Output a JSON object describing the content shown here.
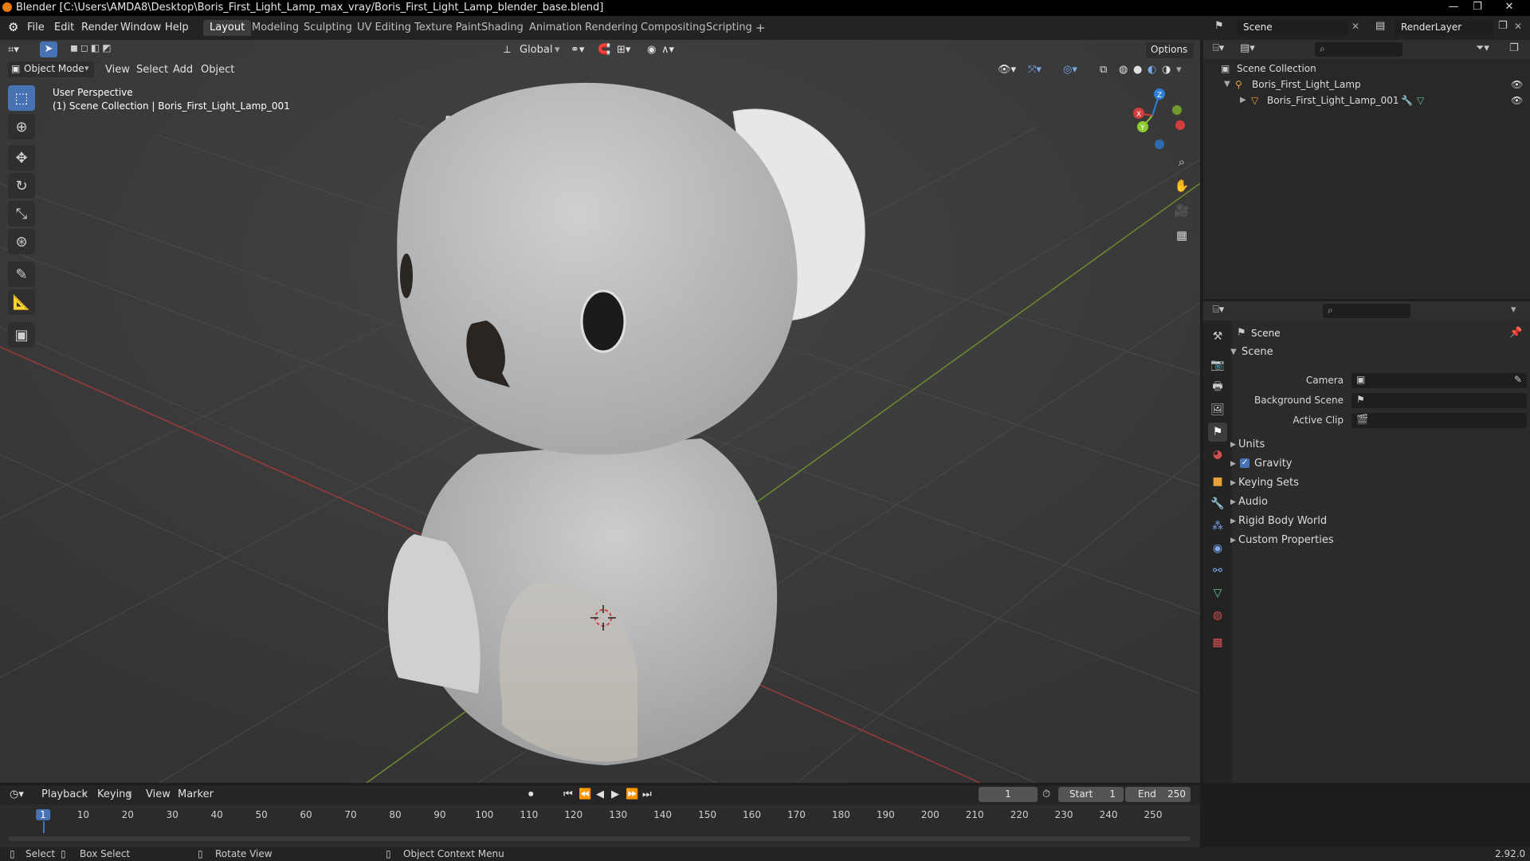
{
  "titlebar": {
    "title": "Blender [C:\\Users\\AMDA8\\Desktop\\Boris_First_Light_Lamp_max_vray/Boris_First_Light_Lamp_blender_base.blend]",
    "min": "—",
    "max": "❐",
    "close": "✕"
  },
  "menu": [
    "File",
    "Edit",
    "Render",
    "Window",
    "Help"
  ],
  "workspaces": [
    "Layout",
    "Modeling",
    "Sculpting",
    "UV Editing",
    "Texture Paint",
    "Shading",
    "Animation",
    "Rendering",
    "Compositing",
    "Scripting"
  ],
  "add_tab": "+",
  "scene_field": "Scene",
  "renderlayer_field": "RenderLayer",
  "viewport": {
    "transform_orientation": "Global",
    "options": "Options",
    "mode": "Object Mode",
    "menus": [
      "View",
      "Select",
      "Add",
      "Object"
    ],
    "overlay_text": "User Perspective",
    "collection_text": "(1) Scene Collection | Boris_First_Light_Lamp_001",
    "gizmo": {
      "x": "X",
      "y": "Y",
      "z": "Z"
    }
  },
  "outliner": {
    "root": "Scene Collection",
    "items": [
      {
        "label": "Boris_First_Light_Lamp"
      },
      {
        "label": "Boris_First_Light_Lamp_001"
      }
    ]
  },
  "properties": {
    "title": "Scene",
    "section": "Scene",
    "fields": [
      {
        "label": "Camera"
      },
      {
        "label": "Background Scene"
      },
      {
        "label": "Active Clip"
      }
    ],
    "subsections": [
      "Units",
      "Gravity",
      "Keying Sets",
      "Audio",
      "Rigid Body World",
      "Custom Properties"
    ],
    "gravity_checked": true
  },
  "timeline": {
    "menus": [
      "Playback",
      "Keying",
      "View",
      "Marker"
    ],
    "current_frame": "1",
    "start_label": "Start",
    "start": "1",
    "end_label": "End",
    "end": "250",
    "ticks": [
      "1",
      "10",
      "20",
      "30",
      "40",
      "50",
      "60",
      "70",
      "80",
      "90",
      "100",
      "110",
      "120",
      "130",
      "140",
      "150",
      "160",
      "170",
      "180",
      "190",
      "200",
      "210",
      "220",
      "230",
      "240",
      "250"
    ]
  },
  "statusbar": {
    "select": "Select",
    "box_select": "Box Select",
    "rotate_view": "Rotate View",
    "context_menu": "Object Context Menu",
    "version": "2.92.0"
  },
  "colors": {
    "accent": "#4772b3",
    "x_axis": "#d63c3c",
    "y_axis": "#8ecb2e",
    "z_axis": "#2e7fd6",
    "model": "#c4c6c8"
  }
}
